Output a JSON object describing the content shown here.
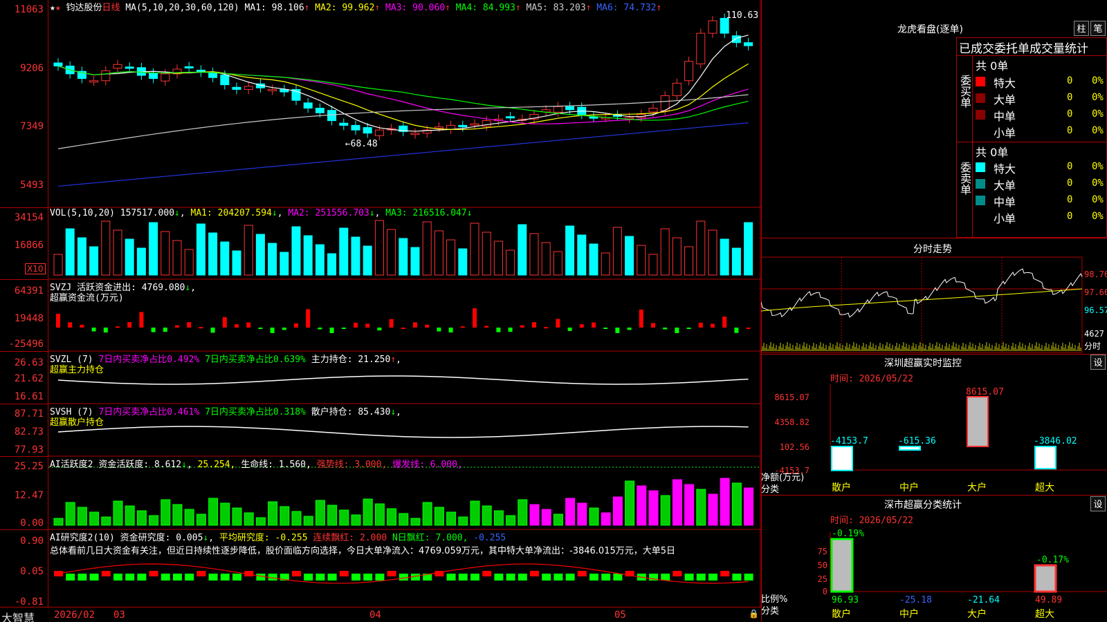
{
  "stock": {
    "name": "钧达股份",
    "period": "日线",
    "ma_params": "MA(5,10,20,30,60,120)",
    "ma_values": [
      {
        "label": "MA1:",
        "value": "98.106",
        "color": "#ffffff"
      },
      {
        "label": "MA2:",
        "value": "99.962",
        "color": "#ffff00"
      },
      {
        "label": "MA3:",
        "value": "90.060",
        "color": "#ff00ff"
      },
      {
        "label": "MA4:",
        "value": "84.993",
        "color": "#00ff00"
      },
      {
        "label": "MA5:",
        "value": "83.203",
        "color": "#cccccc"
      },
      {
        "label": "MA6:",
        "value": "74.732",
        "color": "#3366ff"
      }
    ],
    "high_label": "110.63",
    "low_label": "68.48",
    "price_axis": [
      "11063",
      "9206",
      "7349",
      "5493"
    ]
  },
  "volume": {
    "header": "VOL(5,10,20)",
    "value": "157517.000",
    "ma1": "MA1: 204207.594",
    "ma2": "MA2: 251556.703",
    "ma3": "MA3: 216516.047",
    "axis": [
      "34154",
      "16866"
    ],
    "unit": "X10"
  },
  "svzj": {
    "header": "SVZJ",
    "label": "活跃资金进出:",
    "value": "4769.080",
    "title": "超赢资金流(万元)",
    "axis": [
      "64391",
      "19448",
      "-25496"
    ]
  },
  "svzl": {
    "header": "SVZL (7)",
    "a": "7日内买卖净占比0.492%",
    "b": "7日内买卖净占比0.639%",
    "c": "主力持仓: 21.250",
    "title": "超赢主力持仓",
    "axis": [
      "26.63",
      "21.62",
      "16.61"
    ]
  },
  "svsh": {
    "header": "SVSH (7)",
    "a": "7日内买卖净占比0.461%",
    "b": "7日内买卖净占比0.318%",
    "c": "散户持仓: 85.430",
    "title": "超赢散户持仓",
    "axis": [
      "87.71",
      "82.73",
      "77.93"
    ]
  },
  "ai_active": {
    "header": "AI活跃度2",
    "a": "资金活跃度: 8.612",
    "b": "25.254,",
    "c": "生命线: 1.560,",
    "d": "强势线: 3.000,",
    "e": "爆发线: 6.000,",
    "axis": [
      "25.25",
      "12.47",
      "0.00"
    ]
  },
  "ai_research": {
    "header": "AI研究度2(10)",
    "a": "资金研究度: 0.005",
    "b": "平均研究度: -0.255",
    "c": "连续飘红: 2.000",
    "d": "N日飘红: 7.000,",
    "e": "-0.255",
    "comment": "总体看前几日大资金有关注，但近日持续性逐步降低，股价面临方向选择，今日大单净流入：4769.059万元，其中特大单净流出：-3846.015万元，大单5日",
    "axis": [
      "0.90",
      "0.05",
      "-0.81"
    ]
  },
  "time_axis": [
    "2026/02",
    "03",
    "04",
    "05"
  ],
  "brand": "大智慧",
  "right": {
    "dragon_title": "龙虎看盘(逐单)",
    "btn_zhu": "柱",
    "btn_bi": "笔",
    "stats_title": "已成交委托单成交量统计",
    "buy_side": "委买单",
    "sell_side": "委卖单",
    "buy_total": "共 0单",
    "sell_total": "共 0单",
    "rows": [
      {
        "name": "特大",
        "count": "0",
        "pct": "0%"
      },
      {
        "name": "大单",
        "count": "0",
        "pct": "0%"
      },
      {
        "name": "中单",
        "count": "0",
        "pct": "0%"
      },
      {
        "name": "小单",
        "count": "0",
        "pct": "0%"
      }
    ],
    "intraday_title": "分时走势",
    "intraday_axis": [
      "98.76",
      "97.66",
      "96.57"
    ],
    "intraday_vol": "4627",
    "intraday_label": "分时",
    "monitor_title": "深圳超赢实时监控",
    "monitor_time": "时间: 2026/05/22",
    "monitor_btn": "设",
    "monitor_axis": [
      "8615.07",
      "4358.82",
      "102.56",
      "-4153.7"
    ],
    "monitor_ylabel": "净额(万元)",
    "monitor_xlabel": "分类",
    "monitor_cats": [
      "散户",
      "中户",
      "大户",
      "超大"
    ],
    "monitor_vals": [
      "-4153.7",
      "-615.36",
      "8615.07",
      "-3846.02"
    ],
    "class_title": "深市超赢分类统计",
    "class_time": "时间: 2026/05/22",
    "class_btn": "设",
    "class_axis": [
      "75",
      "50",
      "25",
      "0"
    ],
    "class_ylabel": "比例%",
    "class_xlabel": "分类",
    "class_top": [
      "-0.19%",
      "-0.17%"
    ],
    "class_vals": [
      "96.93",
      "-25.18",
      "-21.64",
      "49.89"
    ]
  }
}
